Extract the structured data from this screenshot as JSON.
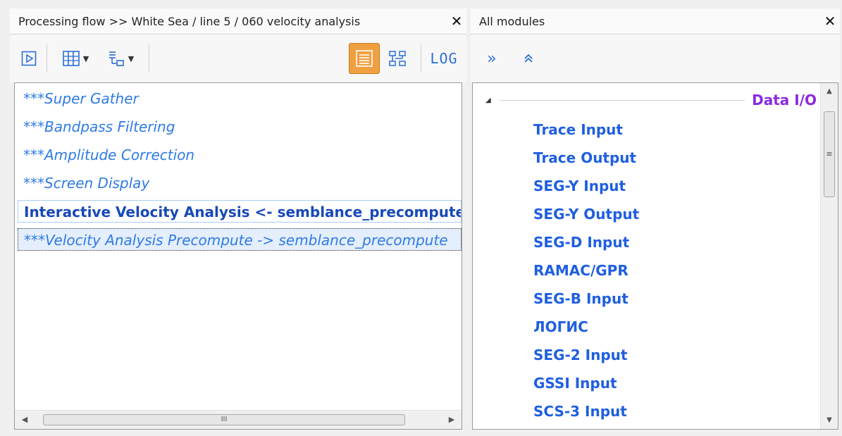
{
  "left_panel": {
    "title": "Processing flow >> White Sea / line 5 / 060 velocity analysis",
    "close_glyph": "✕",
    "toolbar": {
      "run_icon": "play-icon",
      "layout_icon": "columns-icon",
      "sort_icon": "tree-sort-icon",
      "list_view_icon": "list-view-icon",
      "tree_view_icon": "tree-view-icon",
      "log_label": "LOG"
    },
    "flow_items": [
      {
        "label": "***Super Gather",
        "state": "commented"
      },
      {
        "label": "***Bandpass Filtering",
        "state": "commented"
      },
      {
        "label": "***Amplitude Correction",
        "state": "commented"
      },
      {
        "label": "***Screen Display",
        "state": "commented"
      },
      {
        "label": "Interactive Velocity Analysis <- semblance_precompute",
        "state": "active"
      },
      {
        "label": "***Velocity Analysis Precompute -> semblance_precompute",
        "state": "selected"
      }
    ],
    "scroll_thumb_glyph": "III"
  },
  "right_panel": {
    "title": "All modules",
    "close_glyph": "✕",
    "toolbar": {
      "expand_glyph": "»",
      "collapse_glyph": "⌃⌃"
    },
    "group": {
      "name": "Data I/O",
      "expanded": true
    },
    "modules": [
      "Trace Input",
      "Trace Output",
      "SEG-Y Input",
      "SEG-Y Output",
      "SEG-D Input",
      "RAMAC/GPR",
      "SEG-B Input",
      "ЛОГИС",
      "SEG-2 Input",
      "GSSI Input",
      "SCS-3 Input"
    ]
  },
  "colors": {
    "accent_blue": "#2b6fd6",
    "active_toggle": "#f0a040",
    "group_purple": "#8a2be2",
    "module_blue": "#1f5fe0"
  }
}
